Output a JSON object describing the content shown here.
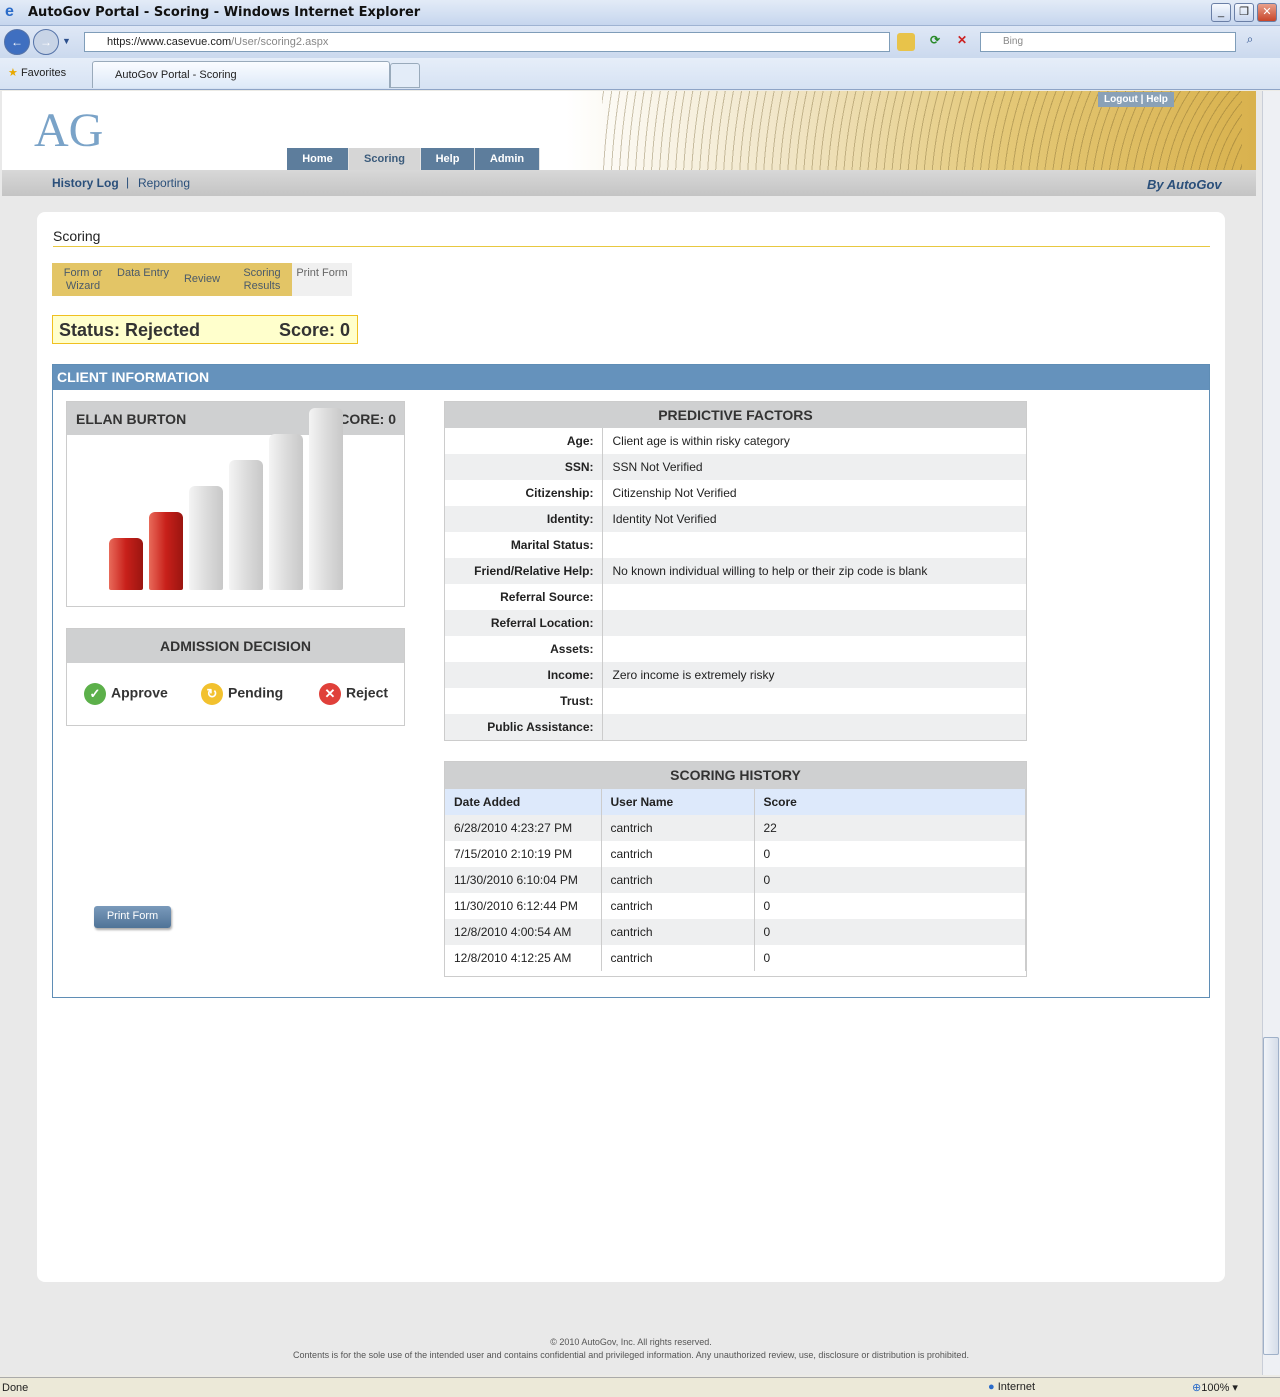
{
  "browser": {
    "title": "AutoGov Portal - Scoring - Windows Internet Explorer",
    "url_scheme": "https://",
    "url_host": "www.casevue.com",
    "url_path": "/User/scoring2.aspx",
    "search_placeholder": "Bing",
    "favorites": "Favorites",
    "tab": "AutoGov Portal - Scoring",
    "status": "Done",
    "zone": "Internet",
    "zoom": "100%"
  },
  "header": {
    "logo": "AG",
    "logout": "Logout",
    "help": "Help",
    "nav": [
      "Home",
      "Scoring",
      "Help",
      "Admin"
    ],
    "subnav": [
      "History Log",
      "Reporting"
    ],
    "byline": "By AutoGov"
  },
  "page": {
    "title": "Scoring",
    "steps": [
      "Form or Wizard",
      "Data Entry",
      "Review",
      "Scoring Results",
      "Print Form"
    ],
    "status": "Status: Rejected",
    "score": "Score: 0"
  },
  "client": {
    "section": "CLIENT INFORMATION",
    "name": "ELLAN BURTON",
    "score_label": "SCORE: 0",
    "meter": {
      "total_bars": 6,
      "active_bars": 2,
      "active_color": "#c8201a"
    },
    "admission": {
      "title": "ADMISSION DECISION",
      "approve": "Approve",
      "pending": "Pending",
      "reject": "Reject"
    },
    "print": "Print Form"
  },
  "factors": {
    "title": "PREDICTIVE FACTORS",
    "rows": [
      {
        "k": "Age:",
        "v": "Client age is within risky category"
      },
      {
        "k": "SSN:",
        "v": "SSN Not Verified"
      },
      {
        "k": "Citizenship:",
        "v": "Citizenship Not Verified"
      },
      {
        "k": "Identity:",
        "v": "Identity Not Verified"
      },
      {
        "k": "Marital Status:",
        "v": ""
      },
      {
        "k": "Friend/Relative Help:",
        "v": "No known individual willing to help or their zip code is blank"
      },
      {
        "k": "Referral Source:",
        "v": ""
      },
      {
        "k": "Referral Location:",
        "v": ""
      },
      {
        "k": "Assets:",
        "v": ""
      },
      {
        "k": "Income:",
        "v": "Zero income is extremely risky"
      },
      {
        "k": "Trust:",
        "v": ""
      },
      {
        "k": "Public Assistance:",
        "v": ""
      }
    ]
  },
  "history": {
    "title": "SCORING HISTORY",
    "cols": [
      "Date Added",
      "User Name",
      "Score"
    ],
    "rows": [
      [
        "6/28/2010 4:23:27 PM",
        "cantrich",
        "22"
      ],
      [
        "7/15/2010 2:10:19 PM",
        "cantrich",
        "0"
      ],
      [
        "11/30/2010 6:10:04 PM",
        "cantrich",
        "0"
      ],
      [
        "11/30/2010 6:12:44 PM",
        "cantrich",
        "0"
      ],
      [
        "12/8/2010 4:00:54 AM",
        "cantrich",
        "0"
      ],
      [
        "12/8/2010 4:12:25 AM",
        "cantrich",
        "0"
      ]
    ]
  },
  "footer": {
    "copyright": "© 2010 AutoGov, Inc. All rights reserved.",
    "notice": "Contents is for the sole use of the intended user and contains confidential and privileged information. Any unauthorized review, use, disclosure or distribution is prohibited."
  }
}
